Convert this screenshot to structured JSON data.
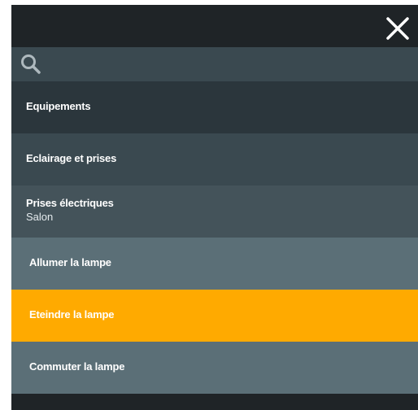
{
  "search": {
    "placeholder": "",
    "value": ""
  },
  "menu": {
    "section_title": "Equipements",
    "category": "Eclairage et prises",
    "device": {
      "name": "Prises électriques",
      "room": "Salon"
    },
    "actions": [
      {
        "label": "Allumer la lampe"
      },
      {
        "label": "Eteindre la lampe",
        "highlighted": true
      },
      {
        "label": "Commuter la lampe"
      }
    ]
  },
  "icons": {
    "close": "close-icon",
    "search": "search-icon"
  },
  "colors": {
    "background": "#1f2427",
    "header_row": "#2b363c",
    "category_row": "#3a4950",
    "device_row": "#44535a",
    "action_row": "#5b6f77",
    "highlight": "#ffaa00",
    "text": "#ffffff"
  }
}
